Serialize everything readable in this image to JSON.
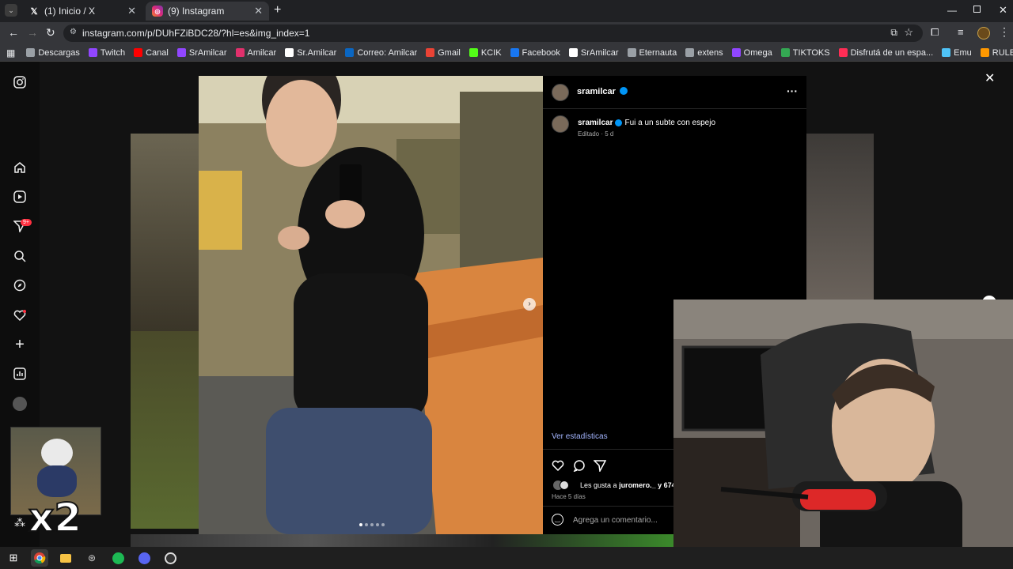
{
  "browser": {
    "tabs": [
      {
        "label": "(1) Inicio / X",
        "icon": "x-logo-icon",
        "active": false
      },
      {
        "label": "(9) Instagram",
        "icon": "instagram-icon",
        "active": true
      }
    ],
    "new_tab": "+",
    "url": "instagram.com/p/DUhFZiBDC28/?hl=es&img_index=1",
    "bookmarks": [
      {
        "label": "Descargas",
        "color": "#9aa0a6"
      },
      {
        "label": "Twitch",
        "color": "#9146ff"
      },
      {
        "label": "Canal",
        "color": "#ff0000"
      },
      {
        "label": "SrAmilcar",
        "color": "#9146ff"
      },
      {
        "label": "Amilcar",
        "color": "#e1306c"
      },
      {
        "label": "Sr.Amilcar",
        "color": "#ffffff"
      },
      {
        "label": "Correo: Amilcar",
        "color": "#0a66c2"
      },
      {
        "label": "Gmail",
        "color": "#ea4335"
      },
      {
        "label": "KCIK",
        "color": "#53fc18"
      },
      {
        "label": "Facebook",
        "color": "#1877f2"
      },
      {
        "label": "SrAmilcar",
        "color": "#ffffff"
      },
      {
        "label": "Eternauta",
        "color": "#9aa0a6"
      },
      {
        "label": "extens",
        "color": "#9aa0a6"
      },
      {
        "label": "Omega",
        "color": "#9146ff"
      },
      {
        "label": "TIKTOKS",
        "color": "#34a853"
      },
      {
        "label": "Disfrutá de un espa...",
        "color": "#ff2d55"
      },
      {
        "label": "Emu",
        "color": "#4fc3f7"
      },
      {
        "label": "RULETA",
        "color": "#ff9800"
      }
    ]
  },
  "sidebar": {
    "notification_badge": "9+"
  },
  "post": {
    "username": "sramilcar",
    "caption": "Fui a un subte con espejo",
    "edited": "Editado · 5 d",
    "stats_link": "Ver estadísticas",
    "likes_prefix": "Les gusta a",
    "likes_user": "juromero._",
    "likes_suffix": " y 674",
    "time": "Hace 5 días",
    "comment_placeholder": "Agrega un comentario...",
    "more": "···",
    "close": "✕",
    "carousel_count": 5,
    "carousel_index": 1
  },
  "overlay": {
    "badge": "x2"
  }
}
